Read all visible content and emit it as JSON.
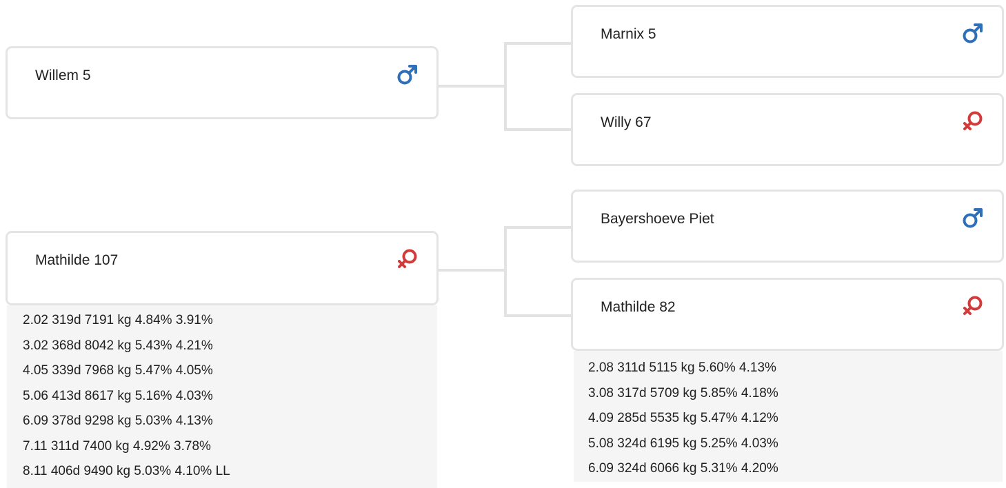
{
  "pedigree": {
    "sire": {
      "name": "Willem 5",
      "sex": "male",
      "sex_icon": "male-symbol-icon"
    },
    "dam": {
      "name": "Mathilde 107",
      "sex": "female",
      "sex_icon": "female-symbol-icon",
      "records": [
        "2.02 319d 7191 kg 4.84% 3.91%",
        "3.02 368d 8042 kg 5.43% 4.21%",
        "4.05 339d 7968 kg 5.47% 4.05%",
        "5.06 413d 8617 kg 5.16% 4.03%",
        "6.09 378d 9298 kg 5.03% 4.13%",
        "7.11 311d 7400 kg 4.92% 3.78%",
        "8.11 406d 9490 kg 5.03% 4.10% LL"
      ]
    },
    "sire_sire": {
      "name": "Marnix 5",
      "sex": "male",
      "sex_icon": "male-symbol-icon"
    },
    "sire_dam": {
      "name": "Willy 67",
      "sex": "female",
      "sex_icon": "female-symbol-icon"
    },
    "dam_sire": {
      "name": "Bayershoeve Piet",
      "sex": "male",
      "sex_icon": "male-symbol-icon"
    },
    "dam_dam": {
      "name": "Mathilde 82",
      "sex": "female",
      "sex_icon": "female-symbol-icon",
      "records": [
        "2.08 311d 5115 kg 5.60% 4.13%",
        "3.08 317d 5709 kg 5.85% 4.18%",
        "4.09 285d 5535 kg 5.47% 4.12%",
        "5.08 324d 6195 kg 5.25% 4.03%",
        "6.09 324d 6066 kg 5.31% 4.20%"
      ]
    }
  },
  "colors": {
    "male": "#2f6fb8",
    "female": "#d23b3b",
    "card_border": "#e4e4e4",
    "connector": "#e2e2e2",
    "records_bg": "#f5f5f5"
  }
}
